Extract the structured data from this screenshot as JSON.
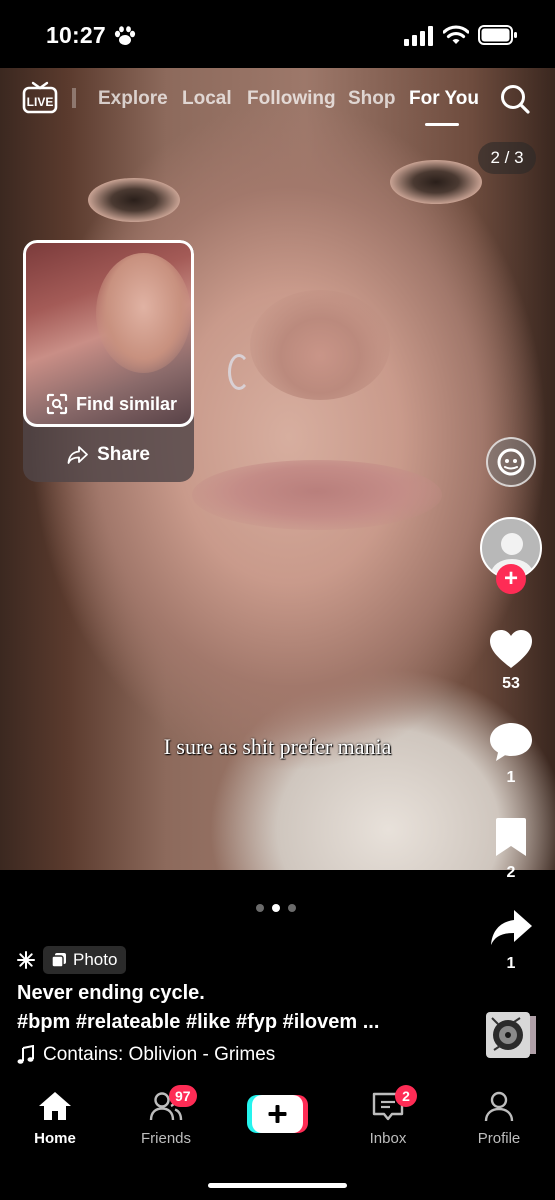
{
  "status_bar": {
    "time": "10:27"
  },
  "top_nav": {
    "live_label": "LIVE",
    "tabs": [
      "Explore",
      "Local",
      "Following",
      "Shop",
      "For You"
    ],
    "active_tab": "For You"
  },
  "post": {
    "counter": "2 / 3",
    "caption_overlay": "I sure as shit prefer mania",
    "find_similar_label": "Find similar",
    "share_label": "Share",
    "likes": "53",
    "comments": "1",
    "saves": "2",
    "shares": "1",
    "type_label": "Photo",
    "title": "Never ending cycle.",
    "hashtags": "#bpm #relateable #like #fyp #ilovem ...",
    "sound": "Contains: Oblivion - Grimes",
    "page_dots": {
      "total": 3,
      "active": 2
    }
  },
  "tab_bar": {
    "home": "Home",
    "friends": "Friends",
    "friends_badge": "97",
    "inbox": "Inbox",
    "inbox_badge": "2",
    "profile": "Profile"
  },
  "colors": {
    "accent": "#fe2c55",
    "create_cyan": "#25f4ee"
  }
}
